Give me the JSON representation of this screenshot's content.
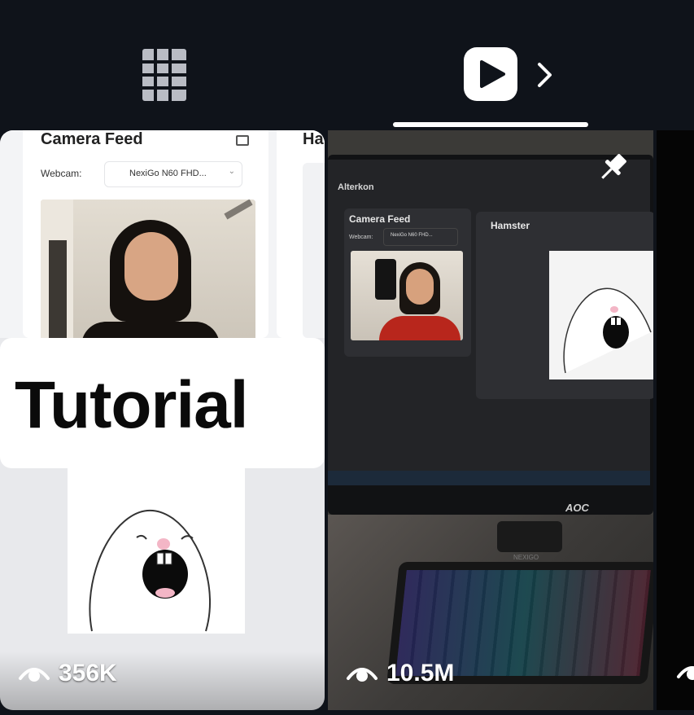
{
  "tabs": [
    {
      "icon": "grid-icon",
      "active": false
    },
    {
      "icon": "play-icon",
      "active": true
    }
  ],
  "videos": [
    {
      "views": "356K",
      "panel_title": "Camera Feed",
      "panel_title_cut": "Ha",
      "webcam_label": "Webcam:",
      "webcam_value": "NexiGo N60 FHD...",
      "overlay_text": "Tutorial"
    },
    {
      "views": "10.5M",
      "pinned": true,
      "app_title": "Alterkon",
      "panel_title": "Camera Feed",
      "panel2_title": "Hamster",
      "webcam_label": "Webcam:",
      "webcam_value": "NexiGo N60 FHD...",
      "monitor_brand": "AOC",
      "camera_brand": "NEXIGO"
    },
    {
      "views": ""
    }
  ],
  "colors": {
    "background": "#0f131a",
    "tab_active": "#ffffff",
    "tab_inactive": "#b9bcc4"
  }
}
